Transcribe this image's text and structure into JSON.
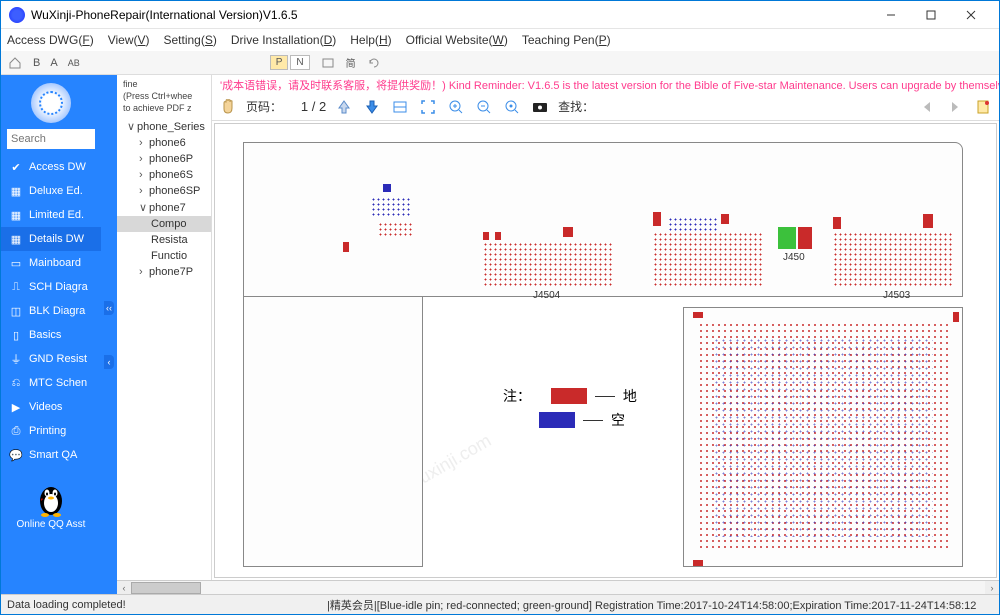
{
  "window": {
    "title": "WuXinji-PhoneRepair(International Version)V1.6.5"
  },
  "menu": {
    "access_dwg": "Access DWG(F)",
    "view": "View(V)",
    "setting": "Setting(S)",
    "drive_install": "Drive Installation(D)",
    "help": "Help(H)",
    "official_website": "Official Website(W)",
    "teaching_pen": "Teaching Pen(P)"
  },
  "toolbar1": {
    "b": "B",
    "a": "A",
    "ab": "AB",
    "p": "P",
    "n": "N"
  },
  "sidebar": {
    "search_placeholder": "Search",
    "items": [
      {
        "label": "Access DW",
        "icon": "check"
      },
      {
        "label": "Deluxe Ed.",
        "icon": "grid"
      },
      {
        "label": "Limited Ed.",
        "icon": "grid"
      },
      {
        "label": "Details DW",
        "icon": "grid",
        "selected": true
      },
      {
        "label": "Mainboard",
        "icon": "board"
      },
      {
        "label": "SCH Diagra",
        "icon": "sch"
      },
      {
        "label": "BLK Diagra",
        "icon": "blk"
      },
      {
        "label": "Basics",
        "icon": "phone"
      },
      {
        "label": "GND Resist",
        "icon": "gnd"
      },
      {
        "label": "MTC Schen",
        "icon": "mtc"
      },
      {
        "label": "Videos",
        "icon": "video"
      },
      {
        "label": "Printing",
        "icon": "print"
      },
      {
        "label": "Smart QA",
        "icon": "chat"
      }
    ],
    "qq_label": "Online QQ Asst"
  },
  "tree": {
    "fine1": "fine",
    "fine2": "(Press Ctrl+whee",
    "fine3": "to achieve PDF z",
    "root": "phone_Series",
    "items": [
      {
        "label": "phone6",
        "level": 1,
        "exp": ">"
      },
      {
        "label": "phone6P",
        "level": 1,
        "exp": ">"
      },
      {
        "label": "phone6S",
        "level": 1,
        "exp": ">"
      },
      {
        "label": "phone6SP",
        "level": 1,
        "exp": ">"
      },
      {
        "label": "phone7",
        "level": 1,
        "exp": "v"
      },
      {
        "label": "Compo",
        "level": 2,
        "selected": true
      },
      {
        "label": "Resista",
        "level": 2
      },
      {
        "label": "Functio",
        "level": 2
      },
      {
        "label": "phone7P",
        "level": 1,
        "exp": ">"
      }
    ]
  },
  "notice": {
    "text": "'成本语错误，请及时联系客服，将提供奖励！) Kind Reminder: V1.6.5 is the latest version for the Bible of Five-star Maintenance. Users can upgrade by themselves or"
  },
  "pdftoolbar": {
    "page_label": "页码：",
    "page_current": "1",
    "page_sep": " / ",
    "page_total": "2",
    "find_label": "查找："
  },
  "schematic": {
    "legend_title": "注：",
    "legend_ground": "地",
    "legend_empty": "空",
    "connector_labels": [
      "J4504",
      "J450",
      "J4503"
    ]
  },
  "statusbar": {
    "left": "Data loading completed!",
    "right": "|精英会员|[Blue-idle pin; red-connected; green-ground]  Registration Time:2017-10-24T14:58:00;Expiration Time:2017-11-24T14:58:12"
  }
}
